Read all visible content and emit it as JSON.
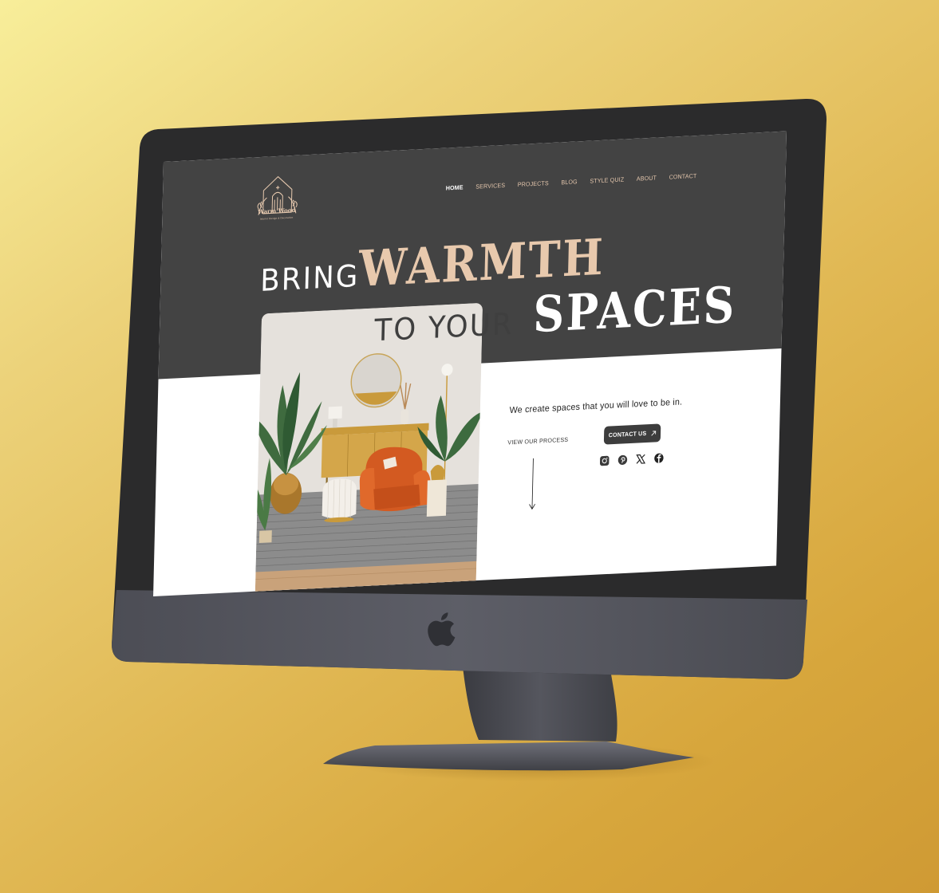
{
  "site": {
    "logo_name": "Warm Wood",
    "logo_tagline": "Interior Design & Decoration"
  },
  "nav": {
    "items": [
      {
        "label": "HOME",
        "active": true
      },
      {
        "label": "SERVICES"
      },
      {
        "label": "PROJECTS"
      },
      {
        "label": "BLOG"
      },
      {
        "label": "STYLE QUIZ"
      },
      {
        "label": "ABOUT"
      },
      {
        "label": "CONTACT"
      }
    ]
  },
  "hero": {
    "line1_light": "BRING",
    "line1_bold": "WARMTH",
    "line2_light": "TO YOUR",
    "line2_bold": "SPACES",
    "tagline": "We create spaces that you will love to be in.",
    "process_link": "VIEW OUR PROCESS",
    "contact_button": "CONTACT US"
  },
  "social": [
    "instagram-icon",
    "pinterest-icon",
    "x-icon",
    "facebook-icon"
  ],
  "colors": {
    "dark": "#434343",
    "accent": "#e8c9ad",
    "background_gold": "#e1b955"
  }
}
